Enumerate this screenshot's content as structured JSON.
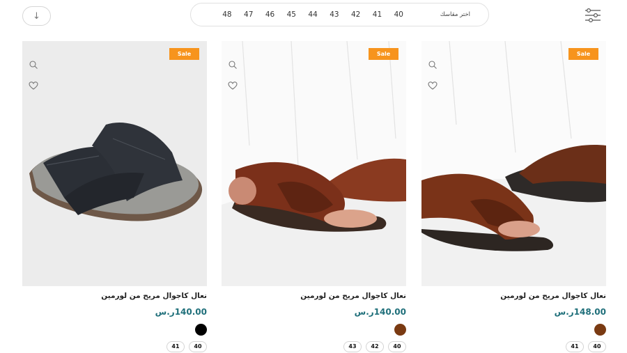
{
  "toolbar": {
    "sort_icon": "arrow-down-icon",
    "filter_icon": "sliders-icon",
    "size_label": "اختر مقاسك",
    "sizes": [
      "40",
      "41",
      "42",
      "43",
      "44",
      "45",
      "46",
      "47",
      "48"
    ]
  },
  "products": [
    {
      "badge": "Sale",
      "title": "نعال كاجوال مريح من لورمين",
      "price": "148.00ر.س",
      "color": "#7a3a12",
      "sizes": [
        "40",
        "41"
      ]
    },
    {
      "badge": "Sale",
      "title": "نعال كاجوال مريح من لورمين",
      "price": "140.00ر.س",
      "color": "#7a3a12",
      "sizes": [
        "40",
        "42",
        "43"
      ]
    },
    {
      "badge": "Sale",
      "title": "نعال كاجوال مريح من لورمين",
      "price": "140.00ر.س",
      "color": "#000000",
      "sizes": [
        "40",
        "41"
      ]
    }
  ],
  "colors": {
    "accent": "#f7941d",
    "price": "#1f6f7a"
  }
}
